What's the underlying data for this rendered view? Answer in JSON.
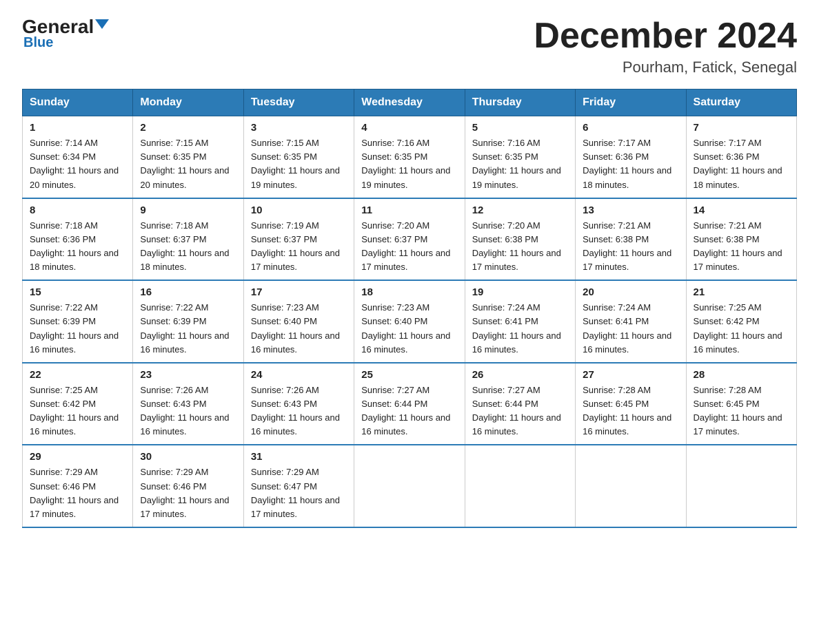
{
  "logo": {
    "general": "General",
    "blue": "Blue"
  },
  "title": "December 2024",
  "subtitle": "Pourham, Fatick, Senegal",
  "days_of_week": [
    "Sunday",
    "Monday",
    "Tuesday",
    "Wednesday",
    "Thursday",
    "Friday",
    "Saturday"
  ],
  "weeks": [
    [
      {
        "day": "1",
        "sunrise": "7:14 AM",
        "sunset": "6:34 PM",
        "daylight": "11 hours and 20 minutes."
      },
      {
        "day": "2",
        "sunrise": "7:15 AM",
        "sunset": "6:35 PM",
        "daylight": "11 hours and 20 minutes."
      },
      {
        "day": "3",
        "sunrise": "7:15 AM",
        "sunset": "6:35 PM",
        "daylight": "11 hours and 19 minutes."
      },
      {
        "day": "4",
        "sunrise": "7:16 AM",
        "sunset": "6:35 PM",
        "daylight": "11 hours and 19 minutes."
      },
      {
        "day": "5",
        "sunrise": "7:16 AM",
        "sunset": "6:35 PM",
        "daylight": "11 hours and 19 minutes."
      },
      {
        "day": "6",
        "sunrise": "7:17 AM",
        "sunset": "6:36 PM",
        "daylight": "11 hours and 18 minutes."
      },
      {
        "day": "7",
        "sunrise": "7:17 AM",
        "sunset": "6:36 PM",
        "daylight": "11 hours and 18 minutes."
      }
    ],
    [
      {
        "day": "8",
        "sunrise": "7:18 AM",
        "sunset": "6:36 PM",
        "daylight": "11 hours and 18 minutes."
      },
      {
        "day": "9",
        "sunrise": "7:18 AM",
        "sunset": "6:37 PM",
        "daylight": "11 hours and 18 minutes."
      },
      {
        "day": "10",
        "sunrise": "7:19 AM",
        "sunset": "6:37 PM",
        "daylight": "11 hours and 17 minutes."
      },
      {
        "day": "11",
        "sunrise": "7:20 AM",
        "sunset": "6:37 PM",
        "daylight": "11 hours and 17 minutes."
      },
      {
        "day": "12",
        "sunrise": "7:20 AM",
        "sunset": "6:38 PM",
        "daylight": "11 hours and 17 minutes."
      },
      {
        "day": "13",
        "sunrise": "7:21 AM",
        "sunset": "6:38 PM",
        "daylight": "11 hours and 17 minutes."
      },
      {
        "day": "14",
        "sunrise": "7:21 AM",
        "sunset": "6:38 PM",
        "daylight": "11 hours and 17 minutes."
      }
    ],
    [
      {
        "day": "15",
        "sunrise": "7:22 AM",
        "sunset": "6:39 PM",
        "daylight": "11 hours and 16 minutes."
      },
      {
        "day": "16",
        "sunrise": "7:22 AM",
        "sunset": "6:39 PM",
        "daylight": "11 hours and 16 minutes."
      },
      {
        "day": "17",
        "sunrise": "7:23 AM",
        "sunset": "6:40 PM",
        "daylight": "11 hours and 16 minutes."
      },
      {
        "day": "18",
        "sunrise": "7:23 AM",
        "sunset": "6:40 PM",
        "daylight": "11 hours and 16 minutes."
      },
      {
        "day": "19",
        "sunrise": "7:24 AM",
        "sunset": "6:41 PM",
        "daylight": "11 hours and 16 minutes."
      },
      {
        "day": "20",
        "sunrise": "7:24 AM",
        "sunset": "6:41 PM",
        "daylight": "11 hours and 16 minutes."
      },
      {
        "day": "21",
        "sunrise": "7:25 AM",
        "sunset": "6:42 PM",
        "daylight": "11 hours and 16 minutes."
      }
    ],
    [
      {
        "day": "22",
        "sunrise": "7:25 AM",
        "sunset": "6:42 PM",
        "daylight": "11 hours and 16 minutes."
      },
      {
        "day": "23",
        "sunrise": "7:26 AM",
        "sunset": "6:43 PM",
        "daylight": "11 hours and 16 minutes."
      },
      {
        "day": "24",
        "sunrise": "7:26 AM",
        "sunset": "6:43 PM",
        "daylight": "11 hours and 16 minutes."
      },
      {
        "day": "25",
        "sunrise": "7:27 AM",
        "sunset": "6:44 PM",
        "daylight": "11 hours and 16 minutes."
      },
      {
        "day": "26",
        "sunrise": "7:27 AM",
        "sunset": "6:44 PM",
        "daylight": "11 hours and 16 minutes."
      },
      {
        "day": "27",
        "sunrise": "7:28 AM",
        "sunset": "6:45 PM",
        "daylight": "11 hours and 16 minutes."
      },
      {
        "day": "28",
        "sunrise": "7:28 AM",
        "sunset": "6:45 PM",
        "daylight": "11 hours and 17 minutes."
      }
    ],
    [
      {
        "day": "29",
        "sunrise": "7:29 AM",
        "sunset": "6:46 PM",
        "daylight": "11 hours and 17 minutes."
      },
      {
        "day": "30",
        "sunrise": "7:29 AM",
        "sunset": "6:46 PM",
        "daylight": "11 hours and 17 minutes."
      },
      {
        "day": "31",
        "sunrise": "7:29 AM",
        "sunset": "6:47 PM",
        "daylight": "11 hours and 17 minutes."
      },
      null,
      null,
      null,
      null
    ]
  ]
}
